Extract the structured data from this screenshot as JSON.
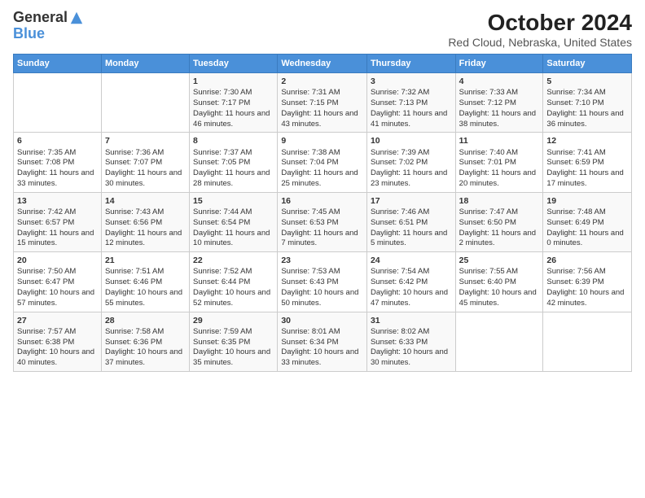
{
  "logo": {
    "line1": "General",
    "line2": "Blue"
  },
  "title": "October 2024",
  "subtitle": "Red Cloud, Nebraska, United States",
  "headers": [
    "Sunday",
    "Monday",
    "Tuesday",
    "Wednesday",
    "Thursday",
    "Friday",
    "Saturday"
  ],
  "weeks": [
    [
      {
        "day": "",
        "sunrise": "",
        "sunset": "",
        "daylight": ""
      },
      {
        "day": "",
        "sunrise": "",
        "sunset": "",
        "daylight": ""
      },
      {
        "day": "1",
        "sunrise": "Sunrise: 7:30 AM",
        "sunset": "Sunset: 7:17 PM",
        "daylight": "Daylight: 11 hours and 46 minutes."
      },
      {
        "day": "2",
        "sunrise": "Sunrise: 7:31 AM",
        "sunset": "Sunset: 7:15 PM",
        "daylight": "Daylight: 11 hours and 43 minutes."
      },
      {
        "day": "3",
        "sunrise": "Sunrise: 7:32 AM",
        "sunset": "Sunset: 7:13 PM",
        "daylight": "Daylight: 11 hours and 41 minutes."
      },
      {
        "day": "4",
        "sunrise": "Sunrise: 7:33 AM",
        "sunset": "Sunset: 7:12 PM",
        "daylight": "Daylight: 11 hours and 38 minutes."
      },
      {
        "day": "5",
        "sunrise": "Sunrise: 7:34 AM",
        "sunset": "Sunset: 7:10 PM",
        "daylight": "Daylight: 11 hours and 36 minutes."
      }
    ],
    [
      {
        "day": "6",
        "sunrise": "Sunrise: 7:35 AM",
        "sunset": "Sunset: 7:08 PM",
        "daylight": "Daylight: 11 hours and 33 minutes."
      },
      {
        "day": "7",
        "sunrise": "Sunrise: 7:36 AM",
        "sunset": "Sunset: 7:07 PM",
        "daylight": "Daylight: 11 hours and 30 minutes."
      },
      {
        "day": "8",
        "sunrise": "Sunrise: 7:37 AM",
        "sunset": "Sunset: 7:05 PM",
        "daylight": "Daylight: 11 hours and 28 minutes."
      },
      {
        "day": "9",
        "sunrise": "Sunrise: 7:38 AM",
        "sunset": "Sunset: 7:04 PM",
        "daylight": "Daylight: 11 hours and 25 minutes."
      },
      {
        "day": "10",
        "sunrise": "Sunrise: 7:39 AM",
        "sunset": "Sunset: 7:02 PM",
        "daylight": "Daylight: 11 hours and 23 minutes."
      },
      {
        "day": "11",
        "sunrise": "Sunrise: 7:40 AM",
        "sunset": "Sunset: 7:01 PM",
        "daylight": "Daylight: 11 hours and 20 minutes."
      },
      {
        "day": "12",
        "sunrise": "Sunrise: 7:41 AM",
        "sunset": "Sunset: 6:59 PM",
        "daylight": "Daylight: 11 hours and 17 minutes."
      }
    ],
    [
      {
        "day": "13",
        "sunrise": "Sunrise: 7:42 AM",
        "sunset": "Sunset: 6:57 PM",
        "daylight": "Daylight: 11 hours and 15 minutes."
      },
      {
        "day": "14",
        "sunrise": "Sunrise: 7:43 AM",
        "sunset": "Sunset: 6:56 PM",
        "daylight": "Daylight: 11 hours and 12 minutes."
      },
      {
        "day": "15",
        "sunrise": "Sunrise: 7:44 AM",
        "sunset": "Sunset: 6:54 PM",
        "daylight": "Daylight: 11 hours and 10 minutes."
      },
      {
        "day": "16",
        "sunrise": "Sunrise: 7:45 AM",
        "sunset": "Sunset: 6:53 PM",
        "daylight": "Daylight: 11 hours and 7 minutes."
      },
      {
        "day": "17",
        "sunrise": "Sunrise: 7:46 AM",
        "sunset": "Sunset: 6:51 PM",
        "daylight": "Daylight: 11 hours and 5 minutes."
      },
      {
        "day": "18",
        "sunrise": "Sunrise: 7:47 AM",
        "sunset": "Sunset: 6:50 PM",
        "daylight": "Daylight: 11 hours and 2 minutes."
      },
      {
        "day": "19",
        "sunrise": "Sunrise: 7:48 AM",
        "sunset": "Sunset: 6:49 PM",
        "daylight": "Daylight: 11 hours and 0 minutes."
      }
    ],
    [
      {
        "day": "20",
        "sunrise": "Sunrise: 7:50 AM",
        "sunset": "Sunset: 6:47 PM",
        "daylight": "Daylight: 10 hours and 57 minutes."
      },
      {
        "day": "21",
        "sunrise": "Sunrise: 7:51 AM",
        "sunset": "Sunset: 6:46 PM",
        "daylight": "Daylight: 10 hours and 55 minutes."
      },
      {
        "day": "22",
        "sunrise": "Sunrise: 7:52 AM",
        "sunset": "Sunset: 6:44 PM",
        "daylight": "Daylight: 10 hours and 52 minutes."
      },
      {
        "day": "23",
        "sunrise": "Sunrise: 7:53 AM",
        "sunset": "Sunset: 6:43 PM",
        "daylight": "Daylight: 10 hours and 50 minutes."
      },
      {
        "day": "24",
        "sunrise": "Sunrise: 7:54 AM",
        "sunset": "Sunset: 6:42 PM",
        "daylight": "Daylight: 10 hours and 47 minutes."
      },
      {
        "day": "25",
        "sunrise": "Sunrise: 7:55 AM",
        "sunset": "Sunset: 6:40 PM",
        "daylight": "Daylight: 10 hours and 45 minutes."
      },
      {
        "day": "26",
        "sunrise": "Sunrise: 7:56 AM",
        "sunset": "Sunset: 6:39 PM",
        "daylight": "Daylight: 10 hours and 42 minutes."
      }
    ],
    [
      {
        "day": "27",
        "sunrise": "Sunrise: 7:57 AM",
        "sunset": "Sunset: 6:38 PM",
        "daylight": "Daylight: 10 hours and 40 minutes."
      },
      {
        "day": "28",
        "sunrise": "Sunrise: 7:58 AM",
        "sunset": "Sunset: 6:36 PM",
        "daylight": "Daylight: 10 hours and 37 minutes."
      },
      {
        "day": "29",
        "sunrise": "Sunrise: 7:59 AM",
        "sunset": "Sunset: 6:35 PM",
        "daylight": "Daylight: 10 hours and 35 minutes."
      },
      {
        "day": "30",
        "sunrise": "Sunrise: 8:01 AM",
        "sunset": "Sunset: 6:34 PM",
        "daylight": "Daylight: 10 hours and 33 minutes."
      },
      {
        "day": "31",
        "sunrise": "Sunrise: 8:02 AM",
        "sunset": "Sunset: 6:33 PM",
        "daylight": "Daylight: 10 hours and 30 minutes."
      },
      {
        "day": "",
        "sunrise": "",
        "sunset": "",
        "daylight": ""
      },
      {
        "day": "",
        "sunrise": "",
        "sunset": "",
        "daylight": ""
      }
    ]
  ]
}
